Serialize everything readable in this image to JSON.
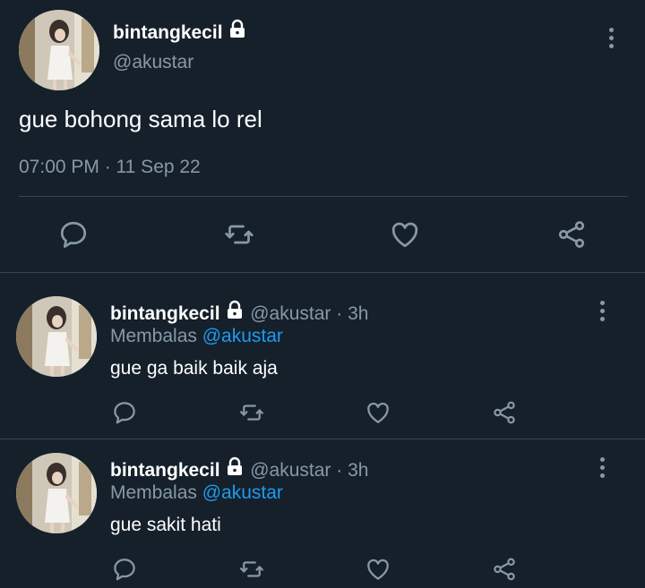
{
  "main_tweet": {
    "display_name": "bintangkecil",
    "handle": "@akustar",
    "text": "gue bohong sama lo rel",
    "timestamp": "07:00 PM · 11 Sep 22",
    "locked": true
  },
  "replies": [
    {
      "display_name": "bintangkecil",
      "handle": "@akustar · 3h",
      "replying_label": "Membalas",
      "replying_to": "@akustar",
      "text": "gue ga baik baik aja"
    },
    {
      "display_name": "bintangkecil",
      "handle": "@akustar · 3h",
      "replying_label": "Membalas",
      "replying_to": "@akustar",
      "text": "gue sakit hati"
    }
  ],
  "colors": {
    "background": "#15202b",
    "text": "#ffffff",
    "muted": "#8899a6",
    "link": "#1d9bf0",
    "divider": "#38444d"
  },
  "icons": [
    "lock-icon",
    "more-icon",
    "reply-icon",
    "retweet-icon",
    "like-icon",
    "share-icon"
  ]
}
